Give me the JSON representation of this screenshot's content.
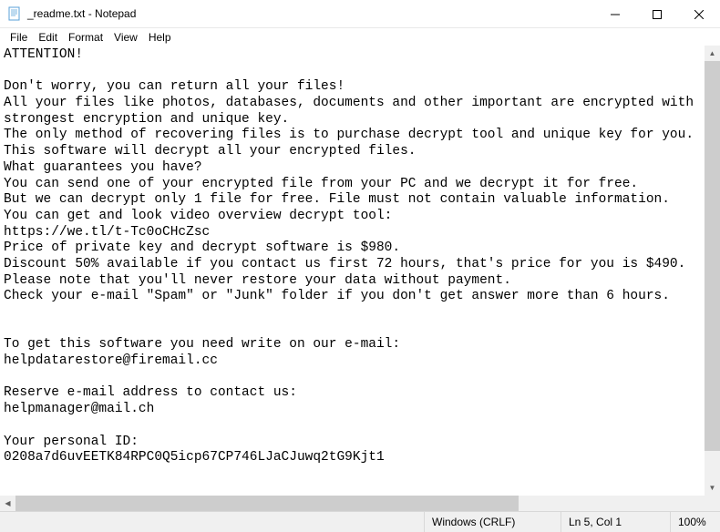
{
  "titlebar": {
    "title": "_readme.txt - Notepad"
  },
  "menu": {
    "file": "File",
    "edit": "Edit",
    "format": "Format",
    "view": "View",
    "help": "Help"
  },
  "content": "ATTENTION!\n\nDon't worry, you can return all your files!\nAll your files like photos, databases, documents and other important are encrypted with strongest encryption and unique key.\nThe only method of recovering files is to purchase decrypt tool and unique key for you.\nThis software will decrypt all your encrypted files.\nWhat guarantees you have?\nYou can send one of your encrypted file from your PC and we decrypt it for free.\nBut we can decrypt only 1 file for free. File must not contain valuable information.\nYou can get and look video overview decrypt tool:\nhttps://we.tl/t-Tc0oCHcZsc\nPrice of private key and decrypt software is $980.\nDiscount 50% available if you contact us first 72 hours, that's price for you is $490.\nPlease note that you'll never restore your data without payment.\nCheck your e-mail \"Spam\" or \"Junk\" folder if you don't get answer more than 6 hours.\n\n\nTo get this software you need write on our e-mail:\nhelpdatarestore@firemail.cc\n\nReserve e-mail address to contact us:\nhelpmanager@mail.ch\n\nYour personal ID:\n0208a7d6uvEETK84RPC0Q5icp67CP746LJaCJuwq2tG9Kjt1",
  "status": {
    "line_ending": "Windows (CRLF)",
    "cursor": "Ln 5, Col 1",
    "zoom": "100%"
  }
}
